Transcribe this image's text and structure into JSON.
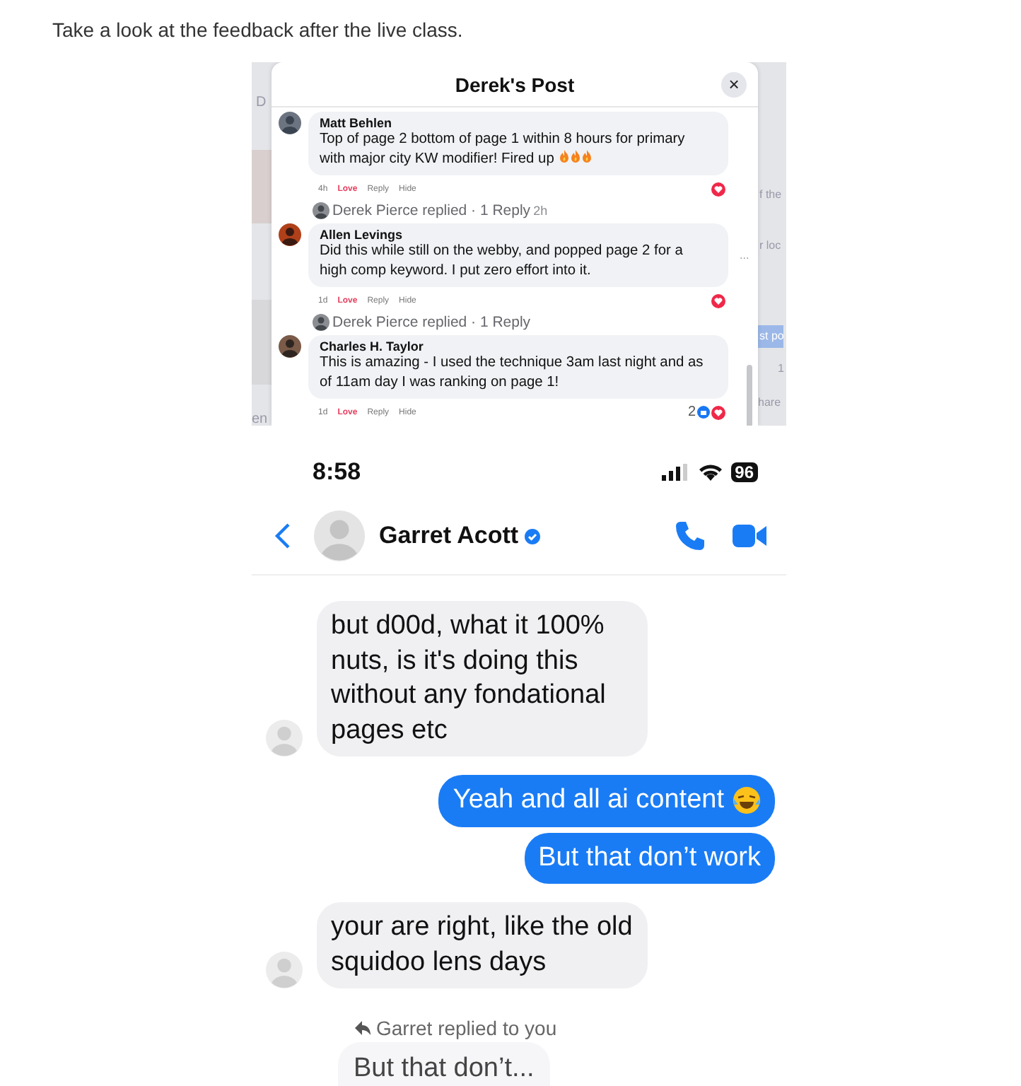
{
  "caption": "Take a look at the feedback after the live class.",
  "post_screenshot": {
    "left_fragments": [
      {
        "text": "D"
      },
      {
        "text": "en"
      }
    ],
    "right_fragments": [
      {
        "text": "f the",
        "highlighted": false
      },
      {
        "text": "r loc",
        "highlighted": false
      },
      {
        "text": "st po",
        "highlighted": true
      },
      {
        "text": "1",
        "highlighted": false
      },
      {
        "text": "hare",
        "highlighted": false
      }
    ],
    "title": "Derek's Post",
    "close": "×",
    "comments": [
      {
        "author": "Matt Behlen",
        "text": "Top of page 2 bottom of page 1 within 8 hours for primary with major city KW modifier! Fired up",
        "fire_icons": true,
        "time": "4h",
        "love": "Love",
        "loved": true,
        "reply": "Reply",
        "hide": "Hide",
        "replies": {
          "text": "Derek Pierce replied · 1 Reply",
          "time": "2h"
        }
      },
      {
        "author": "Allen Levings",
        "text": "Did this while still on the webby, and popped page 2 for a high comp keyword. I put zero effort into it.",
        "fire_icons": false,
        "time": "1d",
        "love": "Love",
        "loved": true,
        "reply": "Reply",
        "hide": "Hide",
        "more": "...",
        "replies": {
          "text": "Derek Pierce replied · 1 Reply"
        }
      },
      {
        "author": "Charles H. Taylor",
        "text": "This is amazing - I used the technique 3am last night and as of 11am day I was ranking on page 1!",
        "fire_icons": false,
        "time": "1d",
        "love": "Love",
        "loved": true,
        "reply": "Reply",
        "hide": "Hide",
        "reaction_count": "2"
      }
    ]
  },
  "chat_screenshot": {
    "time": "8:58",
    "battery": "96",
    "contact": "Garret Acott",
    "verified": true,
    "messages": [
      {
        "kind": "incoming",
        "text": "but d00d, what it 100% nuts, is it's doing this without any fondational pages etc",
        "avatar": true,
        "emoji_icon": false
      },
      {
        "kind": "outgoing",
        "text": "Yeah and all ai content",
        "avatar": false,
        "emoji_icon": true
      },
      {
        "kind": "outgoing",
        "text": "But that don’t work",
        "avatar": false,
        "emoji_icon": false
      },
      {
        "kind": "incoming",
        "text": "your are right, like the old squidoo lens days",
        "avatar": true,
        "emoji_icon": false
      }
    ],
    "reply_note": "Garret replied to you",
    "quoted": "But that don’t..."
  }
}
